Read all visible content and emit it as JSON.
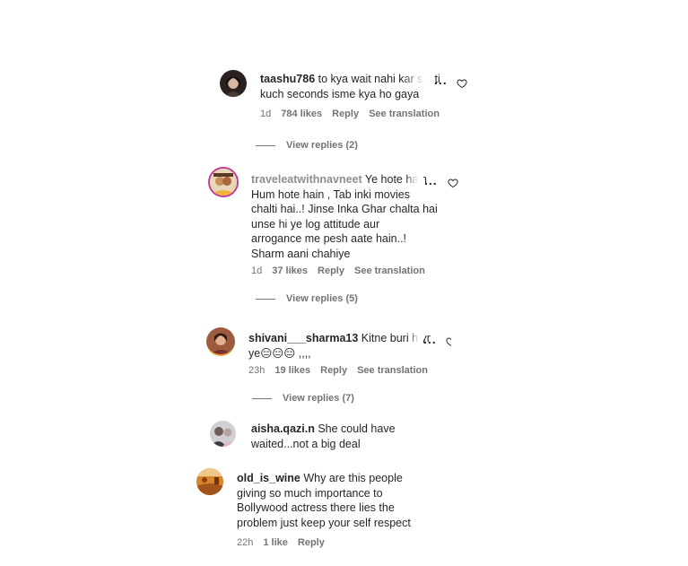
{
  "comments": [
    {
      "username": "taashu786",
      "text_lines": [
        "to kya wait nahi kar sakti",
        "kuch seconds isme kya ho gaya"
      ],
      "time": "1d",
      "likes": "784 likes",
      "reply": "Reply",
      "see_translation": "See translation",
      "replies": "View replies (2)"
    },
    {
      "username": "traveleatwithnavneet",
      "text_lines": [
        "Ye hote hain",
        "Hum hote hain , Tab inki movies",
        "chalti hai..! Jinse Inka Ghar chalta hai",
        "unse hi ye log attitude aur",
        "arrogance me pesh aate hain..!",
        "Sharm aani chahiye"
      ],
      "time": "1d",
      "likes": "37 likes",
      "reply": "Reply",
      "see_translation": "See translation",
      "replies": "View replies (5)"
    },
    {
      "username": "shivani___sharma13",
      "text_lines": [
        "Kitne buri h yr",
        "ye😑😑😑 ,,,,"
      ],
      "time": "23h",
      "likes": "19 likes",
      "reply": "Reply",
      "see_translation": "See translation",
      "replies": "View replies (7)"
    },
    {
      "username": "aisha.qazi.n",
      "text_lines": [
        "She could have",
        "waited...not a big deal"
      ]
    },
    {
      "username": "old_is_wine",
      "text_lines": [
        "Why are this people",
        "giving so much importance to",
        "Bollywood actress there lies the",
        "problem just keep your self respect"
      ],
      "time": "22h",
      "likes": "1 like",
      "reply": "Reply"
    }
  ],
  "more_options": "...",
  "colors": {
    "text": "#262626",
    "muted": "#737373",
    "faded_username": "#8e8e8e"
  }
}
